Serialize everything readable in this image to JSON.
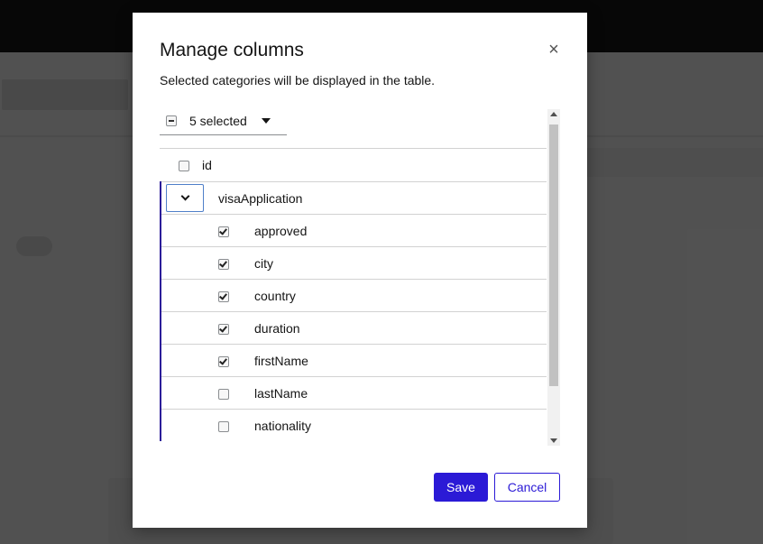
{
  "modal": {
    "title": "Manage columns",
    "close_icon": "×",
    "description": "Selected categories will be displayed in the table."
  },
  "bulk_select": {
    "label": "5 selected",
    "state": "partial"
  },
  "columns": {
    "id": {
      "label": "id",
      "checked": false
    },
    "group": {
      "label": "visaApplication",
      "expanded": true,
      "children": [
        {
          "label": "approved",
          "checked": true
        },
        {
          "label": "city",
          "checked": true
        },
        {
          "label": "country",
          "checked": true
        },
        {
          "label": "duration",
          "checked": true
        },
        {
          "label": "firstName",
          "checked": true
        },
        {
          "label": "lastName",
          "checked": false
        },
        {
          "label": "nationality",
          "checked": false
        }
      ]
    }
  },
  "footer": {
    "save_label": "Save",
    "cancel_label": "Cancel"
  },
  "colors": {
    "primary": "#2b1ad6",
    "group_border": "#2b1a99",
    "backdrop": "#7a7a7a"
  }
}
